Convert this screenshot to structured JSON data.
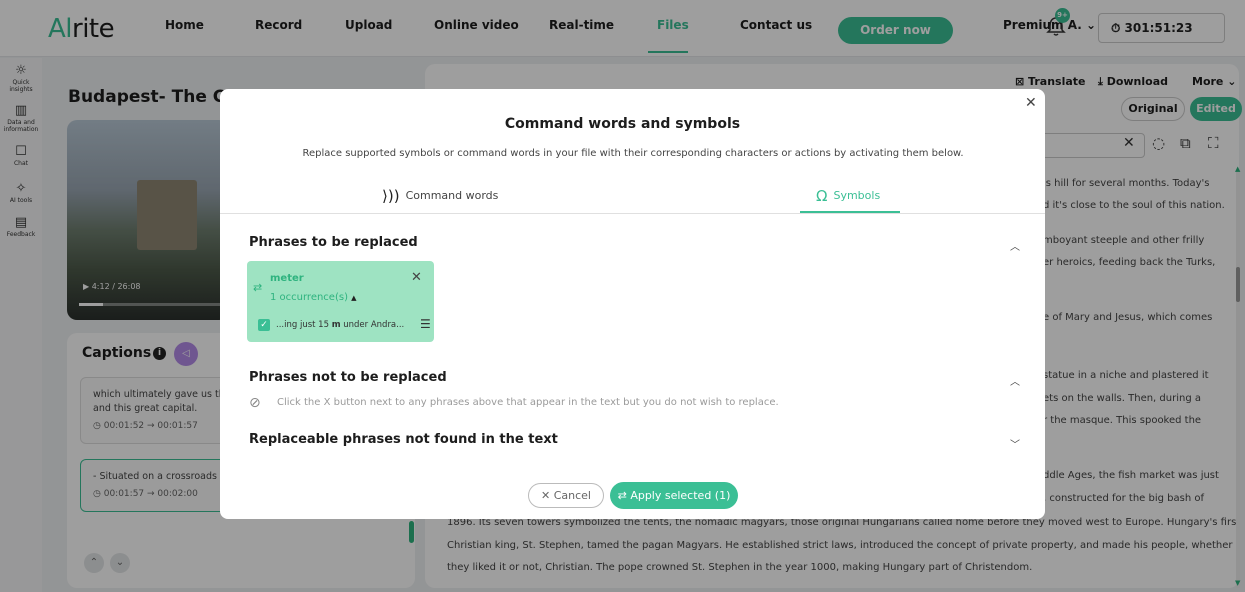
{
  "app": {
    "logo_a": "Al",
    "logo_b": "rite"
  },
  "nav": {
    "items": [
      "Home",
      "Record",
      "Upload",
      "Online video",
      "Real-time",
      "Files",
      "Contact us"
    ],
    "active": "Files",
    "order_label": "Order now",
    "account_label": "Premium A. ⌄",
    "notification_count": "9+",
    "timer": "301:51:23"
  },
  "sidebar": {
    "items": [
      {
        "label": "Quick insights",
        "icon": "lightbulb-icon"
      },
      {
        "label": "Data and information",
        "icon": "bar-chart-icon"
      },
      {
        "label": "Chat",
        "icon": "chat-icon"
      },
      {
        "label": "AI tools",
        "icon": "ai-tools-icon"
      },
      {
        "label": "Feedback",
        "icon": "feedback-icon"
      }
    ]
  },
  "file": {
    "title": "Budapest- The Capital of Hungary",
    "video_time": "4:12 / 26:08",
    "video_progress": 0.16
  },
  "captions": {
    "title": "Captions",
    "cards": [
      {
        "text": "which ultimately gave us the modern nation of Hungary and this great capital.",
        "time": "00:01:52 → 00:01:57"
      },
      {
        "text": "- Situated on a crossroads between Europe and Asia,",
        "time": "00:01:57 → 00:02:00"
      }
    ]
  },
  "document": {
    "actions": {
      "translate": "Translate",
      "download": "Download",
      "more": "More ⌄"
    },
    "view_original": "Original",
    "view_edited": "Edited",
    "right_lines": [
      "is hill for several months. Today's",
      "d it's close to the soul of this nation.",
      "mboyant steeple and other frilly",
      "er heroics, feeding back the Turks,",
      "e of Mary and Jesus, which comes",
      "statue in a niche and plastered it",
      "ets on the walls. Then, during a",
      "r the masque. This spooked the",
      "ddle Ages, the fish market was just",
      ", constructed for the big bash of"
    ],
    "bottom_lines": [
      "1896. Its seven towers symbolized the tents, the nomadic magyars, those original Hungarians called home before they moved west to Europe. Hungary's first",
      "Christian king, St. Stephen, tamed the pagan Magyars. He established strict laws, introduced the concept of private property, and made his people, whether",
      "they liked it or not, Christian. The pope crowned St. Stephen in the year 1000, making Hungary part of Christendom."
    ]
  },
  "modal": {
    "title": "Command words and symbols",
    "subtitle": "Replace supported symbols or command words in your file with their corresponding characters or actions by activating them below.",
    "tabs": [
      {
        "label": "Command words",
        "icon": "voice-command-icon",
        "active": false
      },
      {
        "label": "Symbols",
        "icon": "omega-icon",
        "active": true
      }
    ],
    "sections": {
      "to_replace": "Phrases to be replaced",
      "not_replace": "Phrases not to be replaced",
      "not_found": "Replaceable phrases not found in the text"
    },
    "phrase": {
      "word": "meter",
      "occurrences": "1 occurrence(s)",
      "context_pre": "...ing just 15 ",
      "context_bold": "m",
      "context_post": " under Andra..."
    },
    "hint": "Click the X button next to any phrases above that appear in the text but you do not wish to replace.",
    "cancel_label": "✕  Cancel",
    "apply_label": "Apply selected (1)"
  }
}
